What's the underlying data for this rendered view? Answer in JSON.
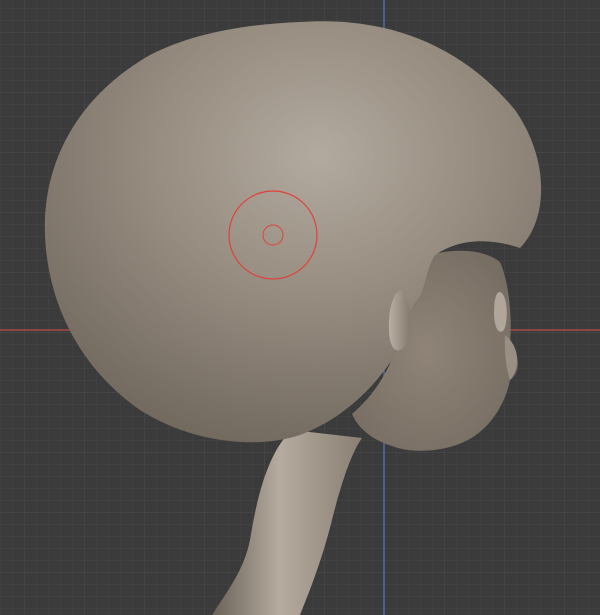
{
  "viewport": {
    "background_color": "#3b3b3b",
    "grid_minor_color": "#444444",
    "grid_major_color": "#4c4c4c",
    "axis_x_color": "#c04a4a",
    "axis_y_color": "#4a7cc0",
    "grid": true
  },
  "model": {
    "skin_base_color": "#8e8376",
    "skin_highlight_color": "#b3aa9f",
    "skin_shadow_color": "#6e655b"
  },
  "brush_cursor": {
    "icon": "sculpt-brush-cursor-icon",
    "color": "#e0413a"
  }
}
